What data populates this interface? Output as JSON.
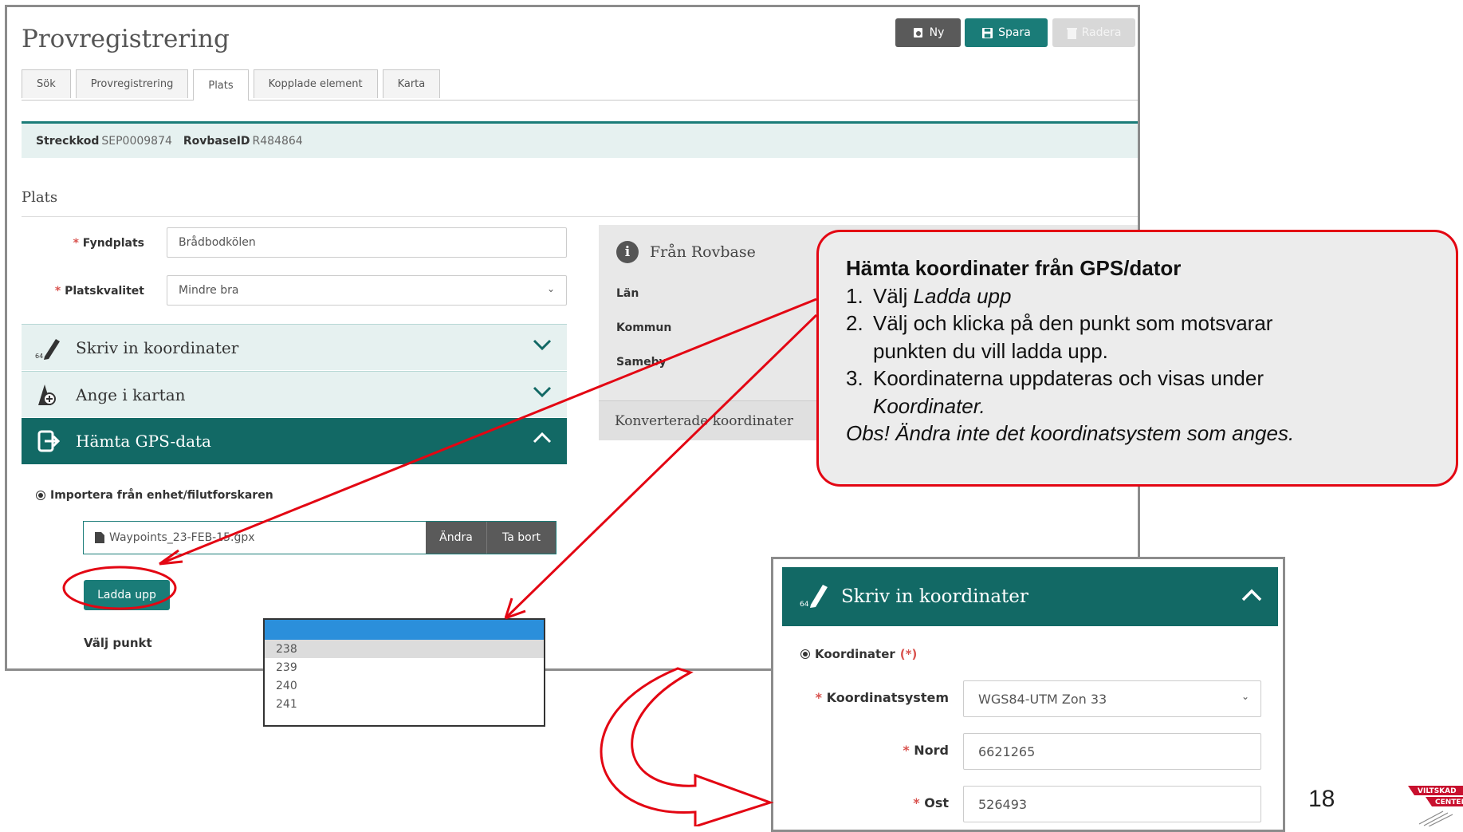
{
  "page_title": "Provregistrering",
  "toolbar": {
    "new_label": "Ny",
    "save_label": "Spara",
    "delete_label": "Radera"
  },
  "tabs": [
    "Sök",
    "Provregistrering",
    "Plats",
    "Kopplade element",
    "Karta"
  ],
  "active_tab": "Plats",
  "ids": {
    "barcode_label": "Streckkod",
    "barcode_value": "SEP0009874",
    "rovbase_label": "RovbaseID",
    "rovbase_value": "R484864"
  },
  "section_title": "Plats",
  "form": {
    "fyndplats_label": "Fyndplats",
    "fyndplats_value": "Brådbodkölen",
    "platskvalitet_label": "Platskvalitet",
    "platskvalitet_value": "Mindre bra"
  },
  "accordions": {
    "skriv": "Skriv in koordinater",
    "ange": "Ange i kartan",
    "hamta": "Hämta GPS-data"
  },
  "gps": {
    "radio_label": "Importera från enhet/filutforskaren",
    "file_name": "Waypoints_23-FEB-15.gpx",
    "change_label": "Ändra",
    "remove_label": "Ta bort",
    "upload_label": "Ladda upp",
    "choose_point_label": "Välj punkt"
  },
  "dropdown_items": [
    "238",
    "239",
    "240",
    "241"
  ],
  "rovbase_panel": {
    "title": "Från Rovbase",
    "lan": "Län",
    "kommun": "Kommun",
    "sameby": "Sameby",
    "converted": "Konverterade koordinater"
  },
  "callout": {
    "heading": "Hämta koordinater från GPS/dator",
    "step1_prefix": "Välj ",
    "step1_em": "Ladda upp",
    "step2a": "Välj och klicka på den punkt som motsvarar",
    "step2b": "punkten du vill ladda upp.",
    "step3": "Koordinaterna uppdateras och visas under",
    "step3_em": "Koordinater.",
    "note": "Obs! Ändra inte det koordinatsystem som anges."
  },
  "inset": {
    "header": "Skriv in koordinater",
    "radio_label": "Koordinater",
    "radio_req": "(*)",
    "system_label": "Koordinatsystem",
    "system_value": "WGS84-UTM Zon 33",
    "nord_label": "Nord",
    "nord_value": "6621265",
    "ost_label": "Ost",
    "ost_value": "526493"
  },
  "required_marker": "*",
  "page_number": "18",
  "logo_text": [
    "VILTSKAD",
    "CENTER"
  ],
  "colors": {
    "teal": "#1a7c78",
    "dark_teal": "#126965",
    "annotation_red": "#e30613",
    "selection_blue": "#2b8fdb"
  }
}
